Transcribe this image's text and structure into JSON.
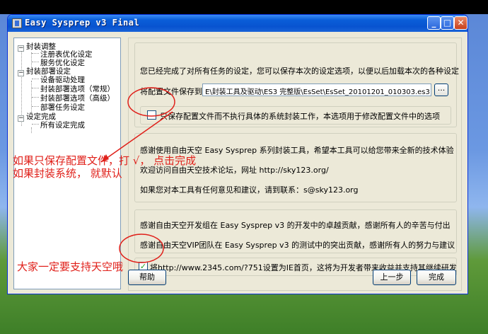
{
  "window": {
    "title": "Easy Sysprep v3 Final"
  },
  "titlebar_buttons": {
    "minimize": "_",
    "maximize": "□",
    "close": "✕"
  },
  "tree": {
    "groups": [
      {
        "label": "封装调整",
        "children": [
          "注册表优化设定",
          "服务优化设定"
        ]
      },
      {
        "label": "封装部署设定",
        "children": [
          "设备驱动处理",
          "封装部署选项（常规）",
          "封装部署选项（高级）",
          "部署任务设定"
        ]
      },
      {
        "label": "设定完成",
        "children": [
          "所有设定完成"
        ]
      }
    ],
    "expander": "−"
  },
  "main": {
    "intro_text": "您已经完成了对所有任务的设定，您可以保存本次的设定选项，以便以后加载本次的各种设定",
    "save_label": "将配置文件保存到",
    "save_path": "E\\封装工具及驱动\\ES3 完整版\\EsSet\\EsSet_20101201_010303.es3",
    "browse_label": "...",
    "only_save_label": "只保存配置文件而不执行具体的系统封装工作，本选项用于修改配置文件中的选项",
    "only_save_checked": false,
    "thanks_line1": "感谢使用自由天空 Easy Sysprep 系列封装工具，希望本工具可以给您带来全新的技术体验",
    "thanks_line2": "欢迎访问自由天空技术论坛，网址 http://sky123.org/",
    "thanks_line3": "如果您对本工具有任何意见和建议，请到联系：s@sky123.org",
    "credits_line1": "感谢自由天空开发组在 Easy Sysprep v3 的开发中的卓越贡献，感谢所有人的辛苦与付出",
    "credits_line2": "感谢自由天空VIP团队在 Easy Sysprep v3 的测试中的突出贡献，感谢所有人的努力与建议",
    "homepage_label": "将http://www.2345.com/?751设置为IE首页，这将为开发者带来收益并支持其继续研发",
    "homepage_checked": true,
    "checkmark": "✓"
  },
  "buttons": {
    "help": "帮助",
    "prev": "上一步",
    "finish": "完成"
  },
  "annotations": {
    "line1": "如果只保存配置文件，打 √， 点击完成",
    "line2": "如果封装系统， 就默认",
    "line3": "大家一定要支持天空哦",
    "color": "#e0201a"
  }
}
